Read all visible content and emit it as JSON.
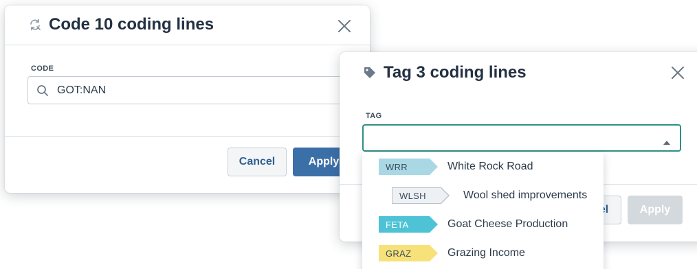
{
  "code_dialog": {
    "title": "Code 10 coding lines",
    "field_label": "CODE",
    "search_value": "GOT:NAN",
    "cancel_label": "Cancel",
    "apply_label": "Apply"
  },
  "tag_dialog": {
    "title": "Tag 3 coding lines",
    "field_label": "TAG",
    "select_value": "",
    "cancel_label": "Cancel",
    "apply_label": "Apply"
  },
  "tag_options": [
    {
      "code": "WRR",
      "label": "White Rock Road",
      "color": "#a9d8e4",
      "text_color": "#3a4c5e",
      "indent": false
    },
    {
      "code": "WLSH",
      "label": "Wool shed improvements",
      "color": "#eef1f4",
      "text_color": "#3a4c5e",
      "indent": true,
      "outlined": true
    },
    {
      "code": "FETA",
      "label": "Goat Cheese Production",
      "color": "#4ec3d5",
      "text_color": "#ffffff",
      "indent": false
    },
    {
      "code": "GRAZ",
      "label": "Grazing Income",
      "color": "#f7e27a",
      "text_color": "#3a4c5e",
      "indent": false
    }
  ],
  "colors": {
    "accent": "#3b6fa8",
    "focus_border": "#2f8f84",
    "disabled": "#d4d9de"
  },
  "icons": {
    "code_title_icon": "refresh-icon",
    "tag_title_icon": "tag-icon",
    "search": "search-icon",
    "close": "close-icon",
    "caret": "caret-up-icon"
  }
}
